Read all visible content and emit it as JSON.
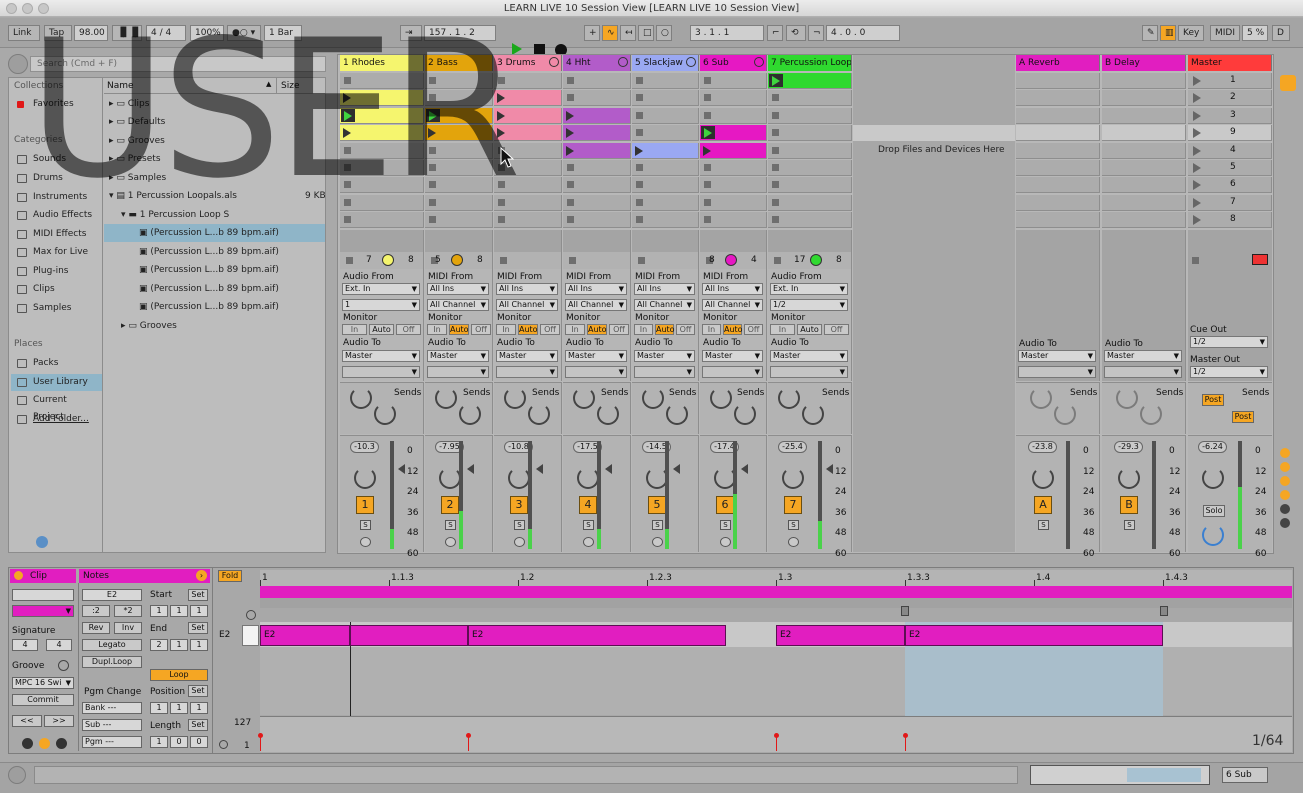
{
  "window": {
    "title": "LEARN LIVE 10 Session View  [LEARN LIVE 10 Session View]"
  },
  "control_bar": {
    "link": "Link",
    "tap": "Tap",
    "tempo": "98.00",
    "sig_num": "4",
    "sig_den": "4",
    "zoom": "100%",
    "quant": "1 Bar",
    "arrangement_pos": "157 .  1 .  2",
    "loop_start": "3 .  1 .  1",
    "loop_len": "4 .  0 .  0",
    "key": "Key",
    "midi": "MIDI",
    "cpu": "5 %",
    "d": "D"
  },
  "browser": {
    "search_placeholder": "Search (Cmd + F)",
    "collections_header": "Collections",
    "favorites": "Favorites",
    "categories_header": "Categories",
    "categories": [
      "Sounds",
      "Drums",
      "Instruments",
      "Audio Effects",
      "MIDI Effects",
      "Max for Live",
      "Plug-ins",
      "Clips",
      "Samples"
    ],
    "places_header": "Places",
    "places": [
      "Packs",
      "User Library",
      "Current Project",
      "Add Folder..."
    ],
    "col_name": "Name",
    "col_size": "Size",
    "files": [
      {
        "name": "Clips",
        "size": ""
      },
      {
        "name": "Defaults",
        "size": ""
      },
      {
        "name": "Grooves",
        "size": ""
      },
      {
        "name": "Presets",
        "size": ""
      },
      {
        "name": "Samples",
        "size": ""
      },
      {
        "name": "1 Percussion Loopals.als",
        "size": "9 KB"
      },
      {
        "name": "1 Percussion Loop S",
        "size": ""
      },
      {
        "name": "(Percussion L...b 89 bpm.aif)",
        "size": ""
      },
      {
        "name": "(Percussion L...b 89 bpm.aif)",
        "size": ""
      },
      {
        "name": "(Percussion L...b 89 bpm.aif)",
        "size": ""
      },
      {
        "name": "(Percussion L...b 89 bpm.aif)",
        "size": ""
      },
      {
        "name": "(Percussion L...b 89 bpm.aif)",
        "size": ""
      },
      {
        "name": "Grooves",
        "size": ""
      }
    ]
  },
  "watermark": "USER",
  "tracks": [
    {
      "name": "1 Rhodes",
      "color": "#f5f56e",
      "io_type": "Audio From",
      "from": "Ext. In",
      "ch": "1",
      "to": "Master",
      "vol": "-10.3",
      "num": "1",
      "clipcount": "7",
      "clipcount2": "8"
    },
    {
      "name": "2 Bass",
      "color": "#e3a40c",
      "io_type": "MIDI From",
      "from": "All Ins",
      "ch": "All Channel",
      "to": "Master",
      "vol": "-7.95",
      "num": "2",
      "clipcount": "5",
      "clipcount2": "8"
    },
    {
      "name": "3 Drums",
      "color": "#f08aa8",
      "io_type": "MIDI From",
      "from": "All Ins",
      "ch": "All Channel",
      "to": "Master",
      "vol": "-10.8",
      "num": "3",
      "clipcount": "",
      "clipcount2": ""
    },
    {
      "name": "4 Hht",
      "color": "#b25cc9",
      "io_type": "MIDI From",
      "from": "All Ins",
      "ch": "All Channel",
      "to": "Master",
      "vol": "-17.5",
      "num": "4",
      "clipcount": "",
      "clipcount2": ""
    },
    {
      "name": "5 Slackjaw",
      "color": "#9aa8f2",
      "io_type": "MIDI From",
      "from": "All Ins",
      "ch": "All Channel",
      "to": "Master",
      "vol": "-14.5",
      "num": "5",
      "clipcount": "",
      "clipcount2": ""
    },
    {
      "name": "6 Sub",
      "color": "#e618c3",
      "io_type": "MIDI From",
      "from": "All Ins",
      "ch": "All Channel",
      "to": "Master",
      "vol": "-17.4",
      "num": "6",
      "clipcount": "8",
      "clipcount2": "4"
    },
    {
      "name": "7 Percussion Loop",
      "color": "#2fd92f",
      "io_type": "Audio From",
      "from": "Ext. In",
      "ch": "1/2",
      "to": "Master",
      "vol": "-25.4",
      "num": "7",
      "clipcount": "17",
      "clipcount2": "8"
    }
  ],
  "drop_text": "Drop Files and Devices Here",
  "returns": [
    {
      "name": "A Reverb",
      "to": "Master",
      "vol": "-23.8",
      "btn": "A"
    },
    {
      "name": "B Delay",
      "to": "Master",
      "vol": "-29.3",
      "btn": "B"
    }
  ],
  "master": {
    "name": "Master",
    "scenes": [
      "1",
      "2",
      "3",
      "9",
      "4",
      "5",
      "6",
      "7",
      "8"
    ],
    "cue_out_label": "Cue Out",
    "cue_out": "1/2",
    "master_out_label": "Master Out",
    "master_out": "1/2",
    "vol": "-6.24",
    "post": "Post",
    "solo": "Solo"
  },
  "labels": {
    "monitor": "Monitor",
    "audio_to": "Audio To",
    "sends": "Sends",
    "in": "In",
    "auto": "Auto",
    "off": "Off",
    "s": "S",
    "ticks": [
      "0",
      "12",
      "24",
      "36",
      "48",
      "60"
    ]
  },
  "clip_panel": {
    "clip": "Clip",
    "notes": "Notes",
    "fold": "Fold",
    "pitch": "E2",
    "div2": ":2",
    "mul2": "*2",
    "rev": "Rev",
    "inv": "Inv",
    "legato": "Legato",
    "dupl": "Dupl.Loop",
    "start": "Start",
    "set": "Set",
    "end": "End",
    "loop": "Loop",
    "position": "Position",
    "length": "Length",
    "signature": "Signature",
    "sig_num": "4",
    "sig_den": "4",
    "groove": "Groove",
    "groove_val": "MPC 16 Swi",
    "commit": "Commit",
    "pgm_change": "Pgm Change",
    "bank": "Bank ---",
    "sub": "Sub ---",
    "pgm": "Pgm ---",
    "start_vals": [
      "1",
      "1",
      "1"
    ],
    "end_vals": [
      "2",
      "1",
      "1"
    ],
    "pos_vals": [
      "1",
      "1",
      "1"
    ],
    "len_vals": [
      "1",
      "0",
      "0"
    ],
    "vel_top": "127",
    "vel_bottom": "1",
    "grid": "1/64",
    "prev": "<<",
    "next": ">>"
  },
  "ruler": [
    "1",
    "1.1.3",
    "1.2",
    "1.2.3",
    "1.3",
    "1.3.3",
    "1.4",
    "1.4.3"
  ],
  "notes": [
    "E2",
    "E2",
    "E2",
    "E2"
  ],
  "status": {
    "track": "6 Sub"
  }
}
